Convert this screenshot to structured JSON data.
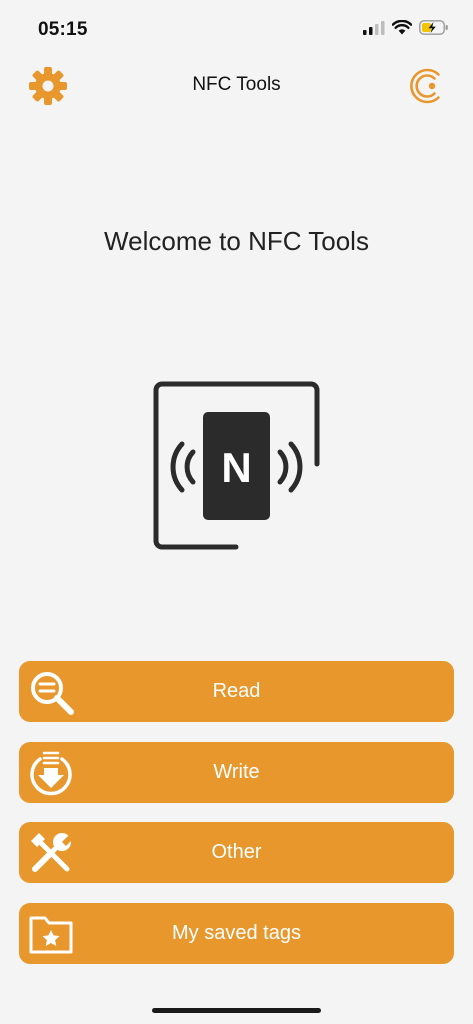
{
  "status_bar": {
    "time": "05:15",
    "icons": [
      "cellular-signal-icon",
      "wifi-icon",
      "battery-charging-icon"
    ]
  },
  "nav": {
    "title": "NFC Tools",
    "left_icon": "gear-icon",
    "right_icon": "brand-logo-icon"
  },
  "main": {
    "welcome": "Welcome to NFC Tools",
    "hero_letter": "N"
  },
  "actions": [
    {
      "label": "Read",
      "icon": "read-magnifier-icon"
    },
    {
      "label": "Write",
      "icon": "write-download-icon"
    },
    {
      "label": "Other",
      "icon": "tools-icon"
    },
    {
      "label": "My saved tags",
      "icon": "folder-star-icon"
    }
  ],
  "colors": {
    "accent": "#e8972d",
    "background": "#f4f4f4",
    "hero_dark": "#2b2b2b"
  }
}
